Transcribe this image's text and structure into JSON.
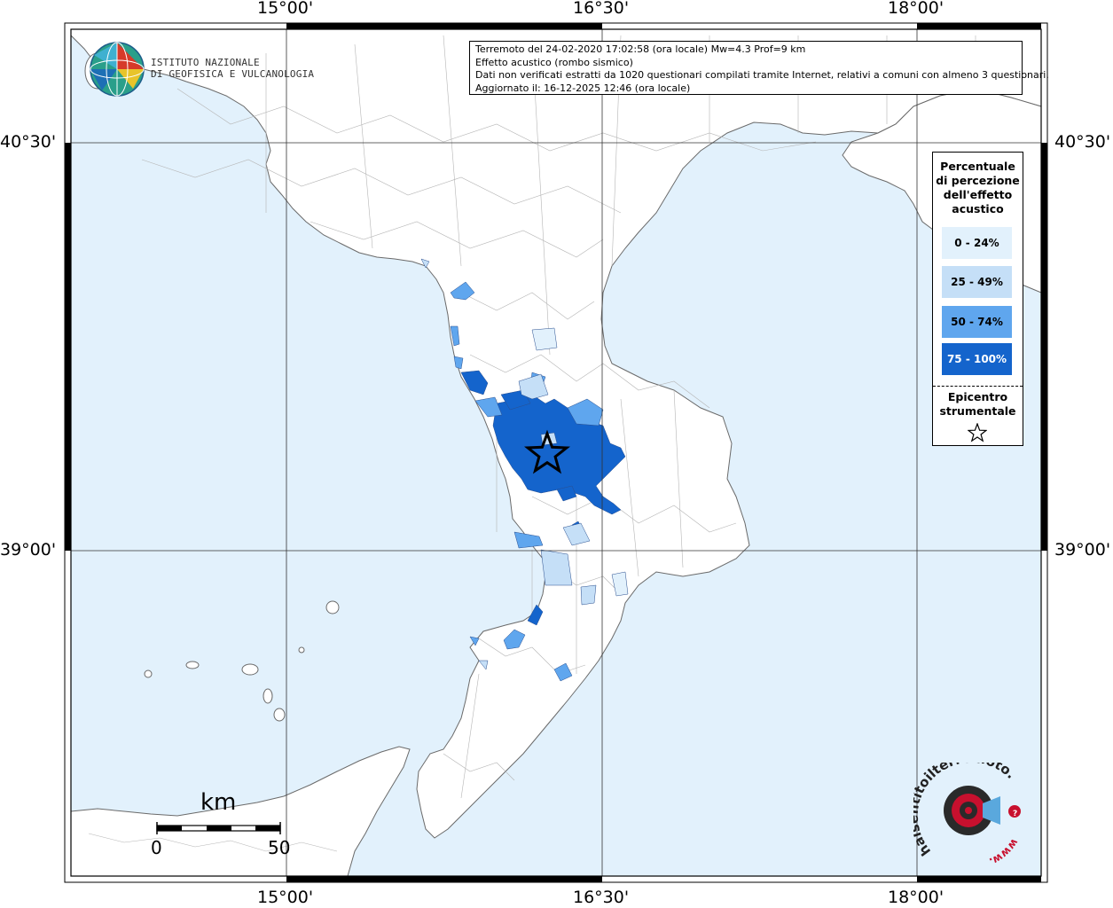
{
  "coords": {
    "top": [
      "15°00'",
      "16°30'",
      "18°00'"
    ],
    "bottom": [
      "15°00'",
      "16°30'",
      "18°00'"
    ],
    "left": [
      "40°30'",
      "39°00'"
    ],
    "right": [
      "40°30'",
      "39°00'"
    ]
  },
  "info": {
    "line1": "Terremoto del 24-02-2020 17:02:58 (ora locale) Mw=4.3 Prof=9 km",
    "line2": "Effetto acustico (rombo sismico)",
    "line3": "Dati non verificati estratti da 1020 questionari compilati tramite Internet, relativi a comuni con almeno 3 questionari.",
    "line4": "Aggiornato il: 16-12-2025 12:46 (ora locale)"
  },
  "legend": {
    "title_lines": [
      "Percentuale",
      "di percezione",
      "dell'effetto",
      "acustico"
    ],
    "classes": [
      {
        "label": "0 - 24%",
        "color": "#e2f1fc",
        "text_color": "#000000"
      },
      {
        "label": "25 - 49%",
        "color": "#c5dff7",
        "text_color": "#000000"
      },
      {
        "label": "50 - 74%",
        "color": "#5fa6ee",
        "text_color": "#000000"
      },
      {
        "label": "75 - 100%",
        "color": "#1464cc",
        "text_color": "#ffffff"
      }
    ],
    "epicenter_lines": [
      "Epicentro",
      "strumentale"
    ]
  },
  "logo": {
    "line1": "ISTITUTO NAZIONALE",
    "line2": "DI GEOFISICA E VULCANOLOGIA"
  },
  "scale": {
    "unit": "km",
    "min": "0",
    "max": "50"
  },
  "hsit": {
    "text": "haisentitoilterremoto.it",
    "www": "www.",
    "q": "?"
  },
  "colors": {
    "sea": "#e2f1fc",
    "land": "#ffffff",
    "border": "#8a8a8a"
  }
}
